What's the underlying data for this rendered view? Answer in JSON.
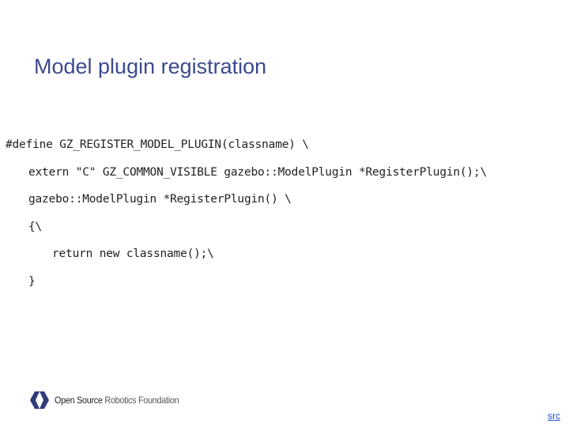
{
  "slide": {
    "title": "Model plugin registration"
  },
  "code": {
    "lines": [
      "#define GZ_REGISTER_MODEL_PLUGIN(classname) \\",
      "extern \"C\" GZ_COMMON_VISIBLE gazebo::ModelPlugin *RegisterPlugin();\\",
      "gazebo::ModelPlugin *RegisterPlugin() \\",
      "{\\",
      "return new classname();\\",
      "}"
    ]
  },
  "footer": {
    "logo_text_bold": "Open Source",
    "logo_text_light": " Robotics Foundation",
    "src_link": "src"
  },
  "colors": {
    "title": "#3b4a8e",
    "link": "#1a4fd6",
    "logo_mark": "#2e3d78"
  },
  "icons": {
    "logo": "osrf-logo-icon"
  }
}
